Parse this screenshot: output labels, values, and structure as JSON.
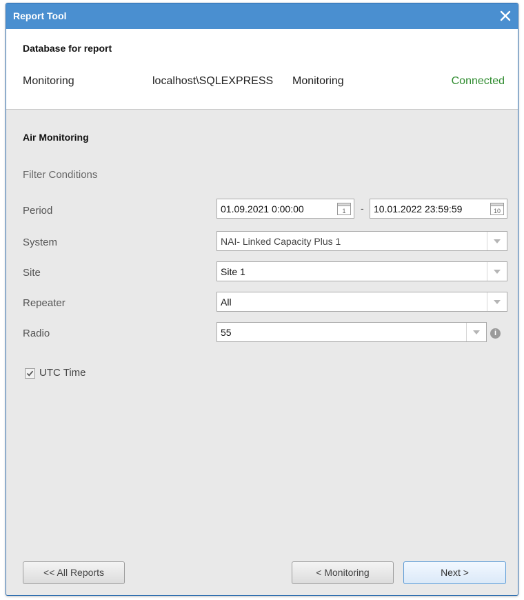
{
  "window": {
    "title": "Report Tool",
    "close_icon": "close-icon"
  },
  "database": {
    "heading": "Database for report",
    "name": "Monitoring",
    "server": "localhost\\SQLEXPRESS",
    "catalog": "Monitoring",
    "status": "Connected",
    "status_color": "#2e8b2e"
  },
  "report": {
    "title": "Air Monitoring",
    "filter_heading": "Filter Conditions",
    "period": {
      "label": "Period",
      "from": "01.09.2021 0:00:00",
      "from_calendar_day": "1",
      "separator": "-",
      "to": "10.01.2022 23:59:59",
      "to_calendar_day": "10"
    },
    "system": {
      "label": "System",
      "value": "NAI- Linked Capacity Plus 1"
    },
    "site": {
      "label": "Site",
      "value": "Site 1"
    },
    "repeater": {
      "label": "Repeater",
      "value": "All"
    },
    "radio": {
      "label": "Radio",
      "value": "55",
      "info_icon": "info-icon"
    },
    "utc": {
      "label": "UTC Time",
      "checked": true
    }
  },
  "buttons": {
    "all_reports": "<< All Reports",
    "back": "< Monitoring",
    "next": "Next >"
  },
  "colors": {
    "titlebar": "#4a8fd0",
    "accent": "#5a9ad6"
  }
}
